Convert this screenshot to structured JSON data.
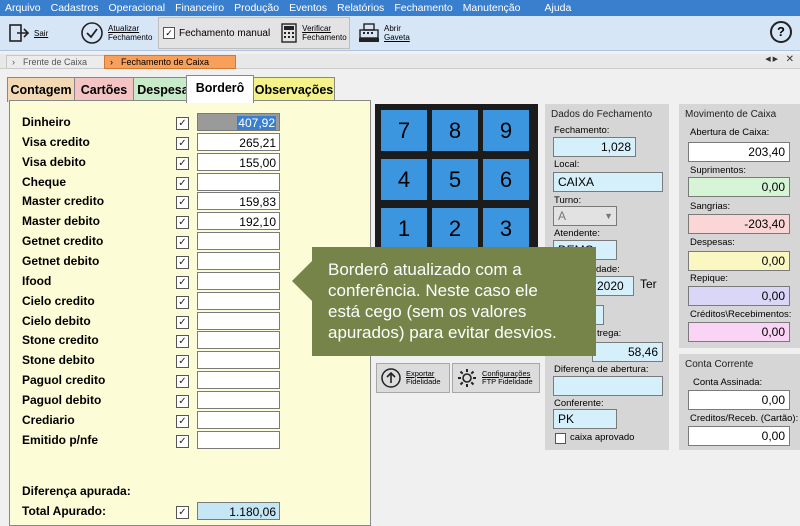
{
  "menu": [
    "Arquivo",
    "Cadastros",
    "Operacional",
    "Financeiro",
    "Produção",
    "Eventos",
    "Relatórios",
    "Fechamento",
    "Manutenção",
    "Ajuda"
  ],
  "toolbar": {
    "sair": "Sair",
    "atualizar_l1": "Atualizar",
    "atualizar_l2": "Fechamento",
    "fechamento_manual": "Fechamento manual",
    "verificar_l1": "Verificar",
    "verificar_l2": "Fechamento",
    "abrir_l1": "Abrir",
    "abrir_l2": "Gaveta",
    "help": "?"
  },
  "page_tabs": [
    "Frente de Caixa",
    "Fechamento de Caixa"
  ],
  "content_tabs": [
    "Contagem",
    "Cartões",
    "Despesa",
    "Borderô",
    "Observações"
  ],
  "rows": [
    {
      "label": "Dinheiro",
      "value": "407,92"
    },
    {
      "label": "Visa credito",
      "value": "265,21"
    },
    {
      "label": "Visa debito",
      "value": "155,00"
    },
    {
      "label": "Cheque",
      "value": ""
    },
    {
      "label": "Master credito",
      "value": "159,83"
    },
    {
      "label": "Master debito",
      "value": "192,10"
    },
    {
      "label": "Getnet credito",
      "value": ""
    },
    {
      "label": "Getnet debito",
      "value": ""
    },
    {
      "label": "Ifood",
      "value": ""
    },
    {
      "label": "Cielo credito",
      "value": ""
    },
    {
      "label": "Cielo debito",
      "value": ""
    },
    {
      "label": "Stone credito",
      "value": ""
    },
    {
      "label": "Stone debito",
      "value": ""
    },
    {
      "label": "Paguol credito",
      "value": ""
    },
    {
      "label": "Paguol debito",
      "value": ""
    },
    {
      "label": "Crediario",
      "value": ""
    },
    {
      "label": "Emitido p/nfe",
      "value": ""
    }
  ],
  "summary": {
    "diferenca_label": "Diferença apurada:",
    "total_label": "Total Apurado:",
    "total_value": "1.180,06"
  },
  "keypad": [
    "7",
    "8",
    "9",
    "4",
    "5",
    "6",
    "1",
    "2",
    "3"
  ],
  "tooltip": {
    "line1": "Borderô atualizado com a",
    "line2": "conferência. Neste caso ele",
    "line3": "está cego (sem os valores",
    "line4": "apurados) para evitar desvios."
  },
  "actions": {
    "exportar_l1": "Exportar",
    "exportar_l2": "Fidelidade",
    "config_l1": "Configurações",
    "config_l2": "FTP Fidelidade"
  },
  "dados": {
    "title": "Dados do Fechamento",
    "fechamento_label": "Fechamento:",
    "fechamento_value": "1,028",
    "local_label": "Local:",
    "local_value": "CAIXA",
    "turno_label": "Turno:",
    "turno_value": "A",
    "atendente_label": "Atendente:",
    "atendente_value": "DEMO",
    "dade_label": "dade:",
    "dade_value": "2020",
    "ter_label": "Ter",
    "entrega_label": "trega:",
    "entrega_value": "58,46",
    "diferenca_label": "Diferença de abertura:",
    "diferenca_value": "",
    "conferente_label": "Conferente:",
    "conferente_value": "PK",
    "caixa_aprovado": "caixa aprovado"
  },
  "movimento": {
    "title": "Movimento de Caixa",
    "abertura_label": "Abertura de Caixa:",
    "abertura_value": "203,40",
    "suprimentos_label": "Suprimentos:",
    "suprimentos_value": "0,00",
    "sangrias_label": "Sangrias:",
    "sangrias_value": "-203,40",
    "despesas_label": "Despesas:",
    "despesas_value": "0,00",
    "repique_label": "Repique:",
    "repique_value": "0,00",
    "creditos_label": "Créditos\\Recebimentos:",
    "creditos_value": "0,00"
  },
  "conta": {
    "title": "Conta Corrente",
    "assinada_label": "Conta Assinada:",
    "assinada_value": "0,00",
    "creditos_label": "Creditos/Receb. (Cartão):",
    "creditos_value": "0,00"
  },
  "colors": {
    "menubar": "#3a7fce",
    "toolbar": "#d7e6f6",
    "active_tab": "#f8a05b",
    "panel_bg": "#fcfcd6",
    "keypad_key": "#3b96df",
    "tooltip": "#76844a"
  }
}
